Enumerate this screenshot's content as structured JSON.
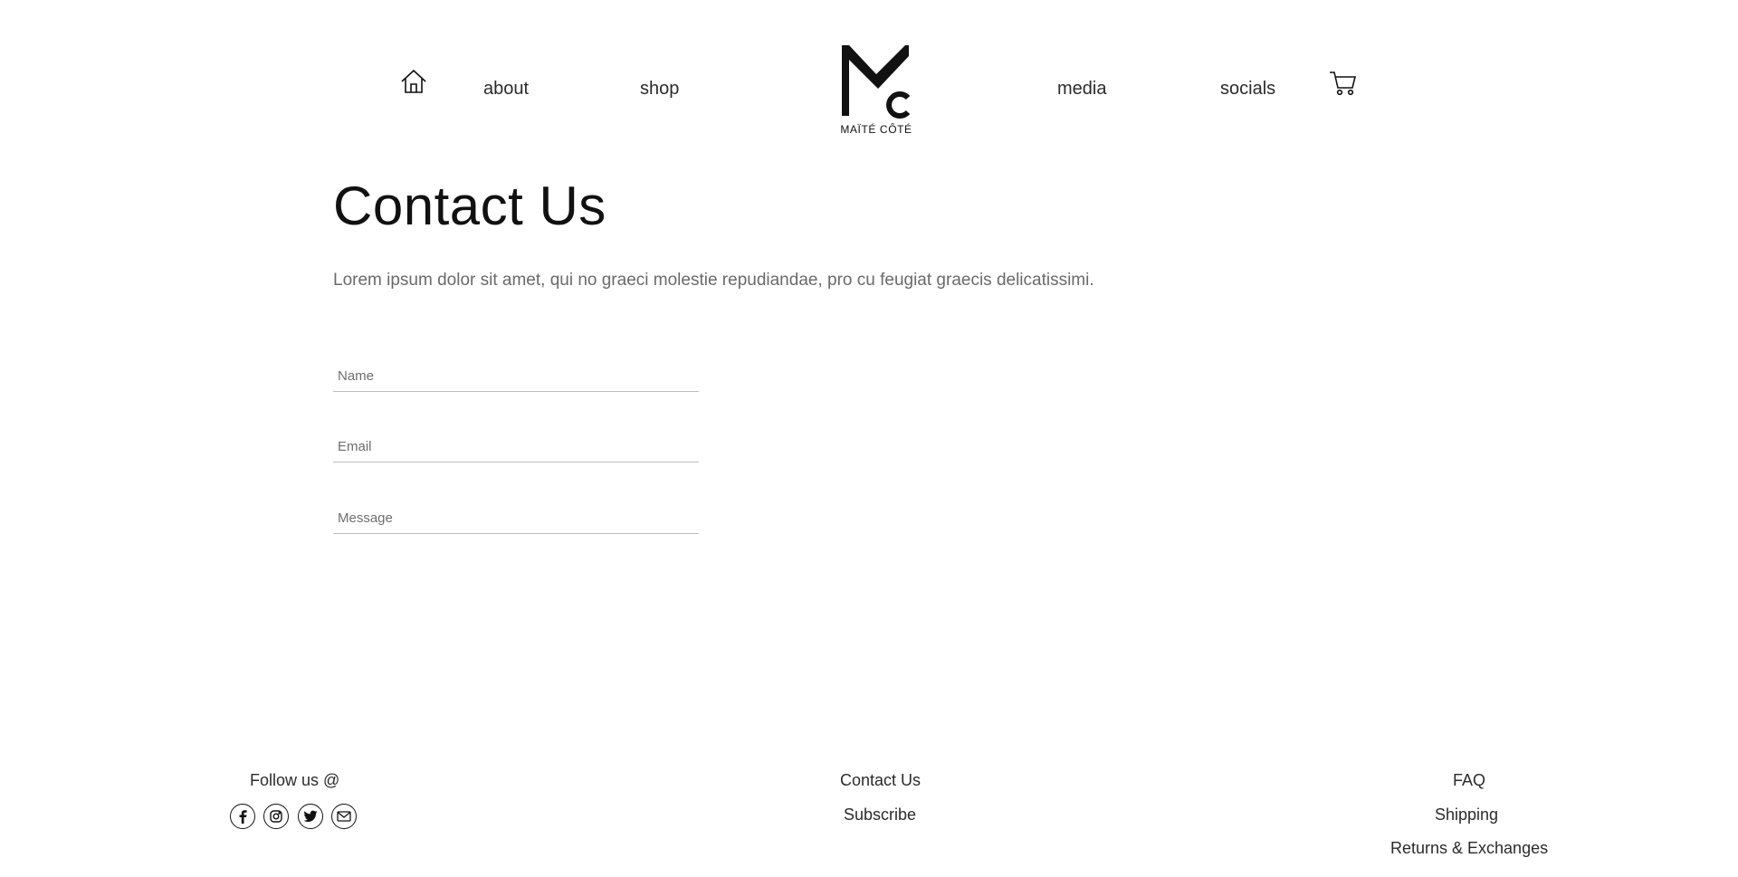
{
  "header": {
    "nav_left": [
      "about",
      "shop"
    ],
    "nav_right": [
      "media",
      "socials"
    ],
    "logo_text": "MAÏTÉ CÔTÉ",
    "icons": {
      "home": "home-icon",
      "cart": "cart-icon"
    }
  },
  "main": {
    "title": "Contact Us",
    "intro": "Lorem ipsum dolor sit amet, qui no graeci molestie repudiandae, pro cu feugiat graecis delicatissimi.",
    "form": {
      "name_placeholder": "Name",
      "email_placeholder": "Email",
      "message_placeholder": "Message"
    }
  },
  "footer": {
    "follow_label": "Follow us @",
    "social_icons": [
      "facebook-icon",
      "instagram-icon",
      "twitter-icon",
      "mail-icon"
    ],
    "center_links": [
      "Contact Us",
      "Subscribe"
    ],
    "right_links": [
      "FAQ",
      "Shipping",
      "Returns & Exchanges"
    ]
  },
  "colors": {
    "text": "#1f1f1f",
    "muted": "#6a6a6a",
    "line": "#bdbdbd",
    "background": "#ffffff"
  }
}
